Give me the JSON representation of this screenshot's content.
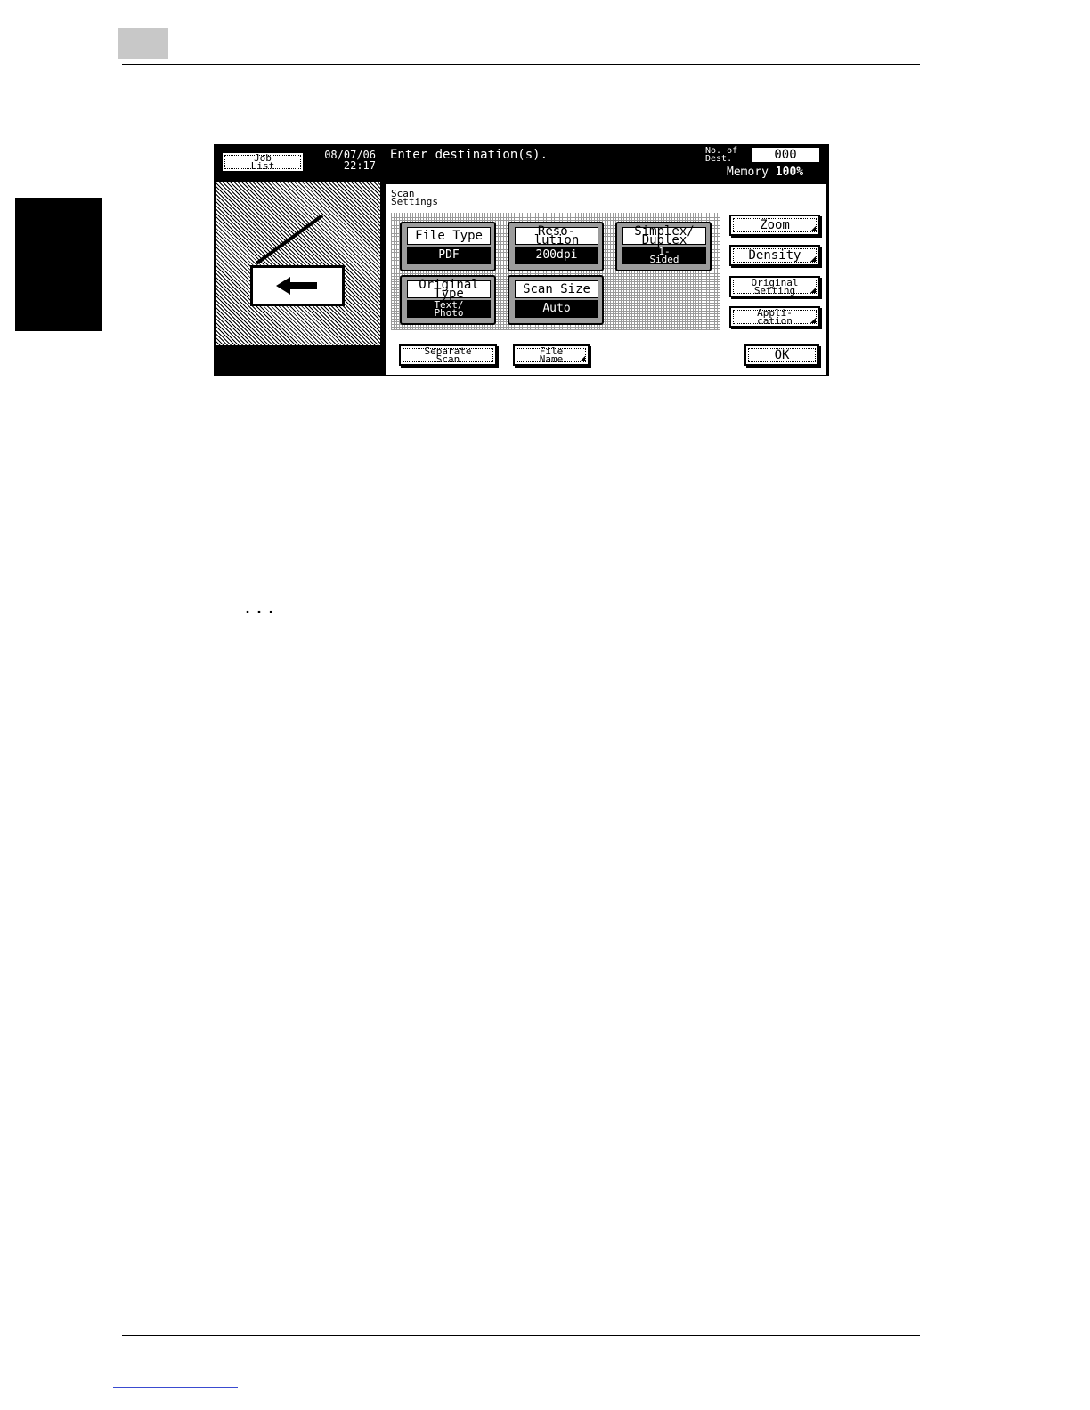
{
  "status_bar": {
    "job_list_label": [
      "Job",
      "List"
    ],
    "date": "08/07/06",
    "time": "22:17",
    "message": "Enter destination(s).",
    "dest_label": [
      "No. of",
      "Dest."
    ],
    "dest_count": "000",
    "memory_label": "Memory",
    "memory_value": "100%"
  },
  "scan_settings": {
    "title": [
      "Scan",
      "Settings"
    ],
    "file_type": {
      "label": [
        "File Type"
      ],
      "value": [
        "PDF"
      ]
    },
    "resolution": {
      "label": [
        "Reso-",
        "lution"
      ],
      "value": [
        "200dpi"
      ]
    },
    "simplex_duplex": {
      "label": [
        "Simplex/",
        "Duplex"
      ],
      "value": [
        "1-",
        "Sided"
      ]
    },
    "original_type": {
      "label": [
        "Original",
        "Type"
      ],
      "value": [
        "Text/",
        "Photo"
      ]
    },
    "scan_size": {
      "label": [
        "Scan Size"
      ],
      "value": [
        "Auto"
      ]
    }
  },
  "side_buttons": {
    "zoom": [
      "Zoom"
    ],
    "density": [
      "Density"
    ],
    "original_setting": [
      "Original",
      "Setting"
    ],
    "application": [
      "Appli-",
      "cation"
    ]
  },
  "bottom_buttons": {
    "separate_scan": [
      "Separate",
      "Scan"
    ],
    "file_name": [
      "File",
      "Name"
    ],
    "ok": [
      "OK"
    ]
  },
  "page": {
    "ellipsis": "..."
  }
}
